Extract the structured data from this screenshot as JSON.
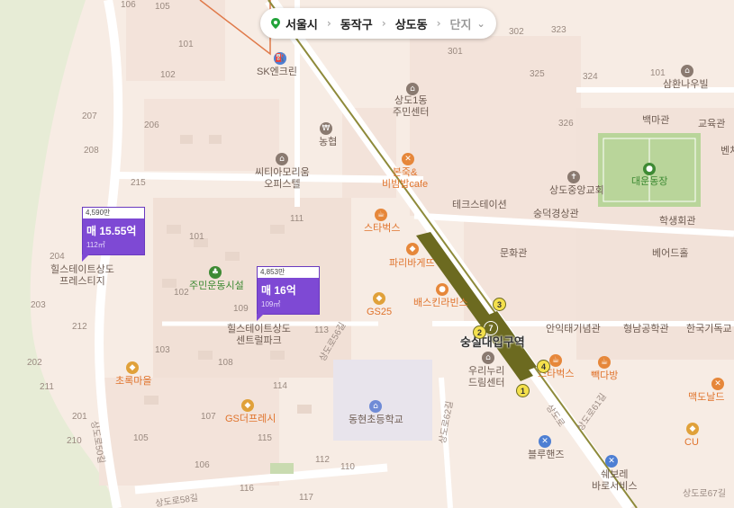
{
  "breadcrumb": {
    "city": "서울시",
    "district": "동작구",
    "neighborhood": "상도동",
    "complex": "단지",
    "pin_color": "#22a33a"
  },
  "listings": [
    {
      "price_per_pyeong": "4,590만",
      "price": "매 15.55억",
      "area": "112㎡"
    },
    {
      "price_per_pyeong": "4,853만",
      "price": "매 16억",
      "area": "109㎡"
    }
  ],
  "station": {
    "name": "숭실대입구역",
    "line_number": "7",
    "line_color": "#6c6a20",
    "exits": [
      "1",
      "2",
      "3",
      "4"
    ]
  },
  "pois": {
    "sk": "SK엔크린",
    "nh": "농협",
    "city_apt_1": "씨티아모리움",
    "city_apt_2": "오피스텔",
    "sangdo1_1": "상도1동",
    "sangdo1_2": "주민센터",
    "bonjuk_1": "본죽&",
    "bonjuk_2": "비빔밥cafe",
    "tescastation": "테크스테이션",
    "munhwa": "문화관",
    "starbucks_1": "스타벅스",
    "paris": "파리바게뜨",
    "baskin": "배스킨라빈스",
    "gs25": "GS25",
    "hillstate_prestige_1": "힐스테이트상도",
    "hillstate_prestige_2": "프레스티지",
    "hillstate_central_1": "힐스테이트상도",
    "hillstate_central_2": "센트럴파크",
    "community": "주민운동시설",
    "chorok": "초록마을",
    "gsfresh": "GS더프레시",
    "donghyeon": "동현초등학교",
    "urinuri_1": "우리누리",
    "urinuri_2": "드림센터",
    "starbucks_2": "스타벅스",
    "paddaban": "빽다방",
    "bluehands": "블루핸즈",
    "shbore_1": "쉐보레",
    "shbore_2": "바로서비스",
    "cu": "CU",
    "mcdonalds": "맥도날드",
    "sangdo_church": "상도중앙교회",
    "suyuk": "숭덕경상관",
    "hakseng": "학생회관",
    "beotal": "베어드홀",
    "anik": "안익태기념관",
    "hyeongnam": "형남공학관",
    "hanguk": "한국기독교",
    "baekmagwan": "백마관",
    "gyoyuk": "교육관",
    "daeun": "대운동장",
    "samhwan": "삼환나우빌",
    "bench": "벤처"
  },
  "roads": {
    "r56": "상도로56길",
    "r62": "상도로62길",
    "r61": "상도로61길",
    "r50": "상도로50길",
    "r58": "상도로58길",
    "r67": "상도로67길",
    "sangdoro": "상도로"
  },
  "block_numbers": [
    "106",
    "105",
    "101",
    "102",
    "207",
    "206",
    "208",
    "215",
    "204",
    "203",
    "212",
    "202",
    "211",
    "210",
    "201",
    "111",
    "101",
    "102",
    "103",
    "108",
    "109",
    "113",
    "107",
    "114",
    "105",
    "115",
    "106",
    "116",
    "112",
    "110",
    "117",
    "301",
    "302",
    "323",
    "325",
    "324",
    "326",
    "101"
  ],
  "colors": {
    "listing_purple": "#7e49d4",
    "map_background": "#f7ece4",
    "park_green": "#e3ead3",
    "line7": "#6c6a20"
  }
}
